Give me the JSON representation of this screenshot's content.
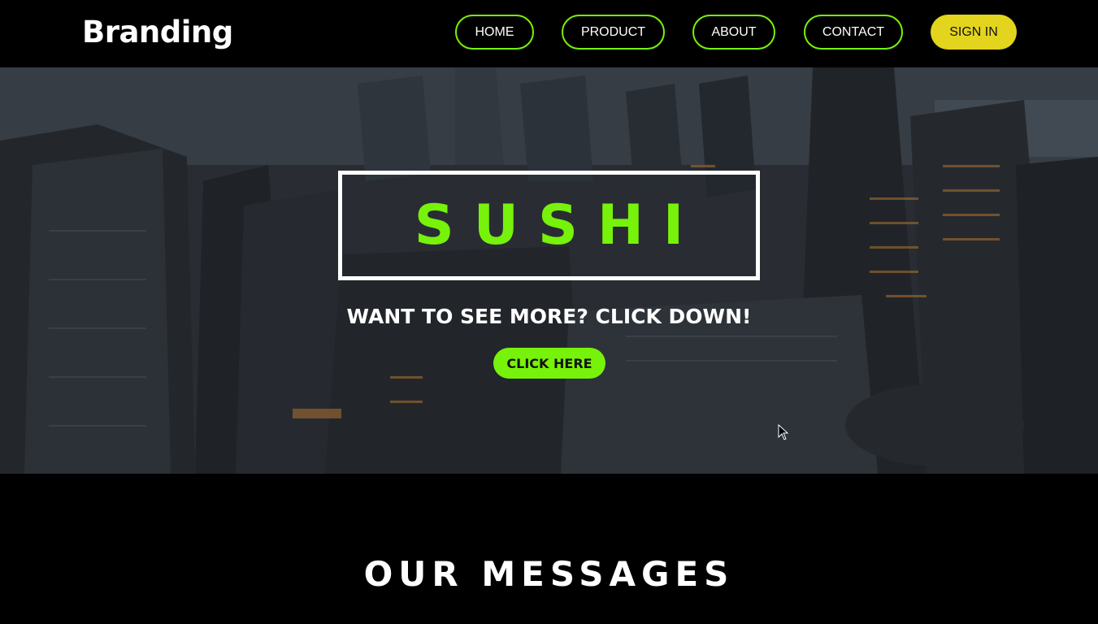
{
  "nav": {
    "brand": "Branding",
    "items": [
      "HOME",
      "PRODUCT",
      "ABOUT",
      "CONTACT"
    ],
    "signin": "SIGN IN"
  },
  "hero": {
    "title": "SUSHI",
    "subtitle": "WANT TO SEE MORE? CLICK DOWN!",
    "cta": "CLICK HERE"
  },
  "section": {
    "title": "OUR MESSAGES"
  },
  "colors": {
    "accent": "#77f20a",
    "signin": "#e3d41e",
    "background": "#000000"
  }
}
